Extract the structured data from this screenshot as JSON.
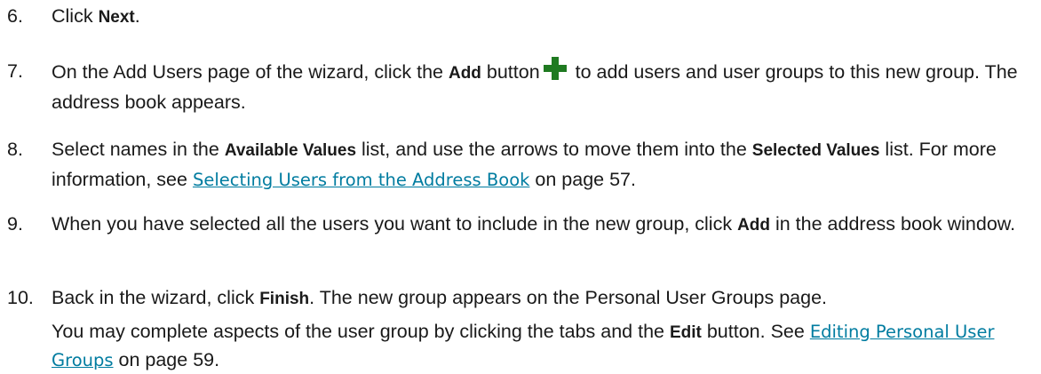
{
  "steps": [
    {
      "number": "6.",
      "parts": [
        "Click ",
        "Next",
        "."
      ]
    },
    {
      "number": "7.",
      "parts": [
        "On the Add Users page of the wizard, click the ",
        "Add",
        " button",
        " to add users and user groups to this new group. The address book appears."
      ],
      "icon": "add-plus-icon"
    },
    {
      "number": "8.",
      "parts": [
        "Select names in the ",
        "Available Values",
        " list, and use the arrows to move them into the ",
        "Selected Values",
        " list. For more information, see ",
        "Selecting Users from the Address Book",
        " on page 57."
      ]
    },
    {
      "number": "9.",
      "parts": [
        "When you have selected all the users you want to include in the new group, click ",
        "Add",
        " in the address book window."
      ]
    },
    {
      "number": "10.",
      "parts": [
        "Back in the wizard, click ",
        "Finish",
        ". The new group appears on the Personal User Groups page."
      ],
      "note": [
        "You may complete aspects of the user group by clicking the tabs and the ",
        "Edit",
        " button. See ",
        "Editing Personal User Groups",
        " on page 59."
      ]
    }
  ],
  "colors": {
    "link": "#007ca0",
    "icon": "#1f7a21",
    "text": "#1a1a1a"
  }
}
